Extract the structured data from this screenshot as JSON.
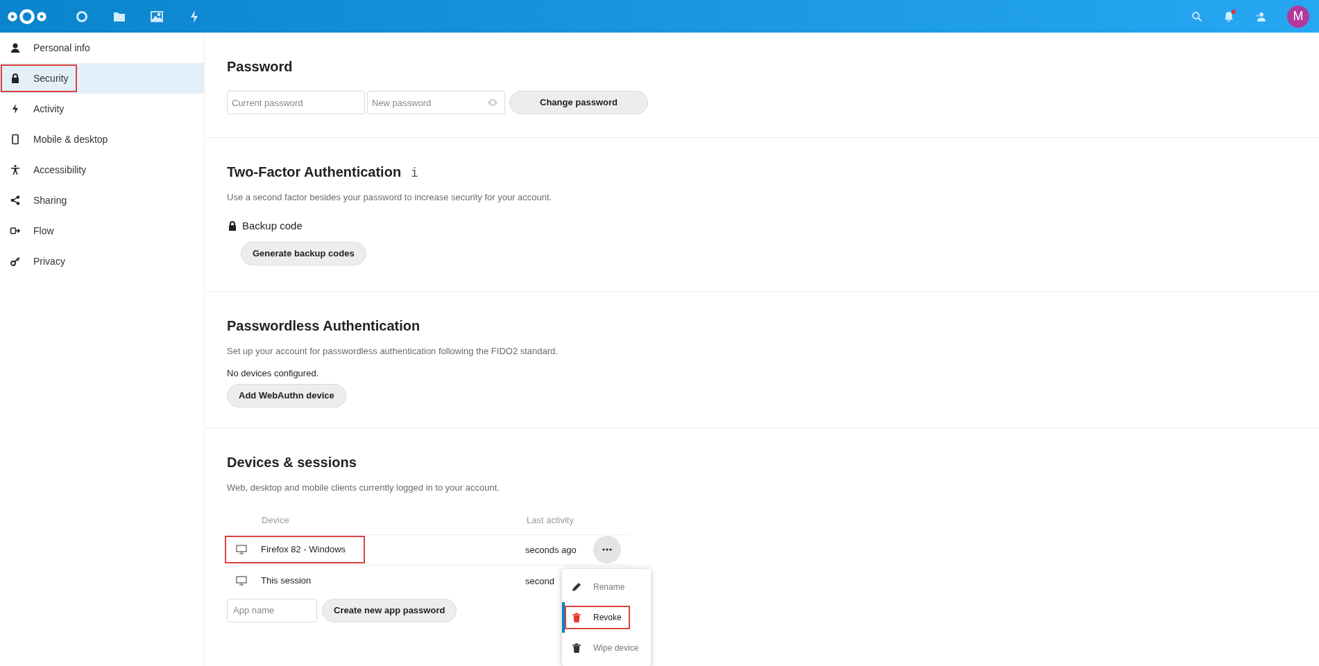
{
  "header": {
    "apps": [
      {
        "kind": "dashboard"
      },
      {
        "kind": "files"
      },
      {
        "kind": "photos"
      },
      {
        "kind": "activity"
      }
    ],
    "avatar": "M",
    "notification_unread": true
  },
  "sidebar": {
    "items": [
      {
        "kind": "person",
        "label": "Personal info",
        "selected": false,
        "highlighted": false
      },
      {
        "kind": "lock",
        "label": "Security",
        "selected": true,
        "highlighted": true
      },
      {
        "kind": "bolt",
        "label": "Activity",
        "selected": false,
        "highlighted": false
      },
      {
        "kind": "phone",
        "label": "Mobile & desktop",
        "selected": false,
        "highlighted": false
      },
      {
        "kind": "accessibility",
        "label": "Accessibility",
        "selected": false,
        "highlighted": false
      },
      {
        "kind": "share",
        "label": "Sharing",
        "selected": false,
        "highlighted": false
      },
      {
        "kind": "flow",
        "label": "Flow",
        "selected": false,
        "highlighted": false
      },
      {
        "kind": "key",
        "label": "Privacy",
        "selected": false,
        "highlighted": false
      }
    ]
  },
  "password": {
    "title": "Password",
    "current_placeholder": "Current password",
    "new_placeholder": "New password",
    "button": "Change password"
  },
  "two_factor": {
    "title": "Two-Factor Authentication",
    "info": "i",
    "description": "Use a second factor besides your password to increase security for your account.",
    "provider": "Backup code",
    "button": "Generate backup codes"
  },
  "passwordless": {
    "title": "Passwordless Authentication",
    "description": "Set up your account for passwordless authentication following the FIDO2 standard.",
    "status": "No devices configured.",
    "button": "Add WebAuthn device"
  },
  "devices": {
    "title": "Devices & sessions",
    "description": "Web, desktop and mobile clients currently logged in to your account.",
    "columns": [
      "Device",
      "Last activity"
    ],
    "rows": [
      {
        "device": "Firefox 82 - Windows",
        "last_activity": "seconds ago",
        "highlighted": true,
        "menu_open": true
      },
      {
        "device": "This session",
        "last_activity": "second",
        "highlighted": false,
        "menu_open": false
      }
    ],
    "app_name_placeholder": "App name",
    "create_button": "Create new app password",
    "menu": [
      {
        "kind": "pencil",
        "label": "Rename",
        "selected": false,
        "highlighted": false
      },
      {
        "kind": "trash-red",
        "label": "Revoke",
        "selected": true,
        "highlighted": true
      },
      {
        "kind": "trash",
        "label": "Wipe device",
        "selected": false,
        "highlighted": false
      }
    ]
  }
}
